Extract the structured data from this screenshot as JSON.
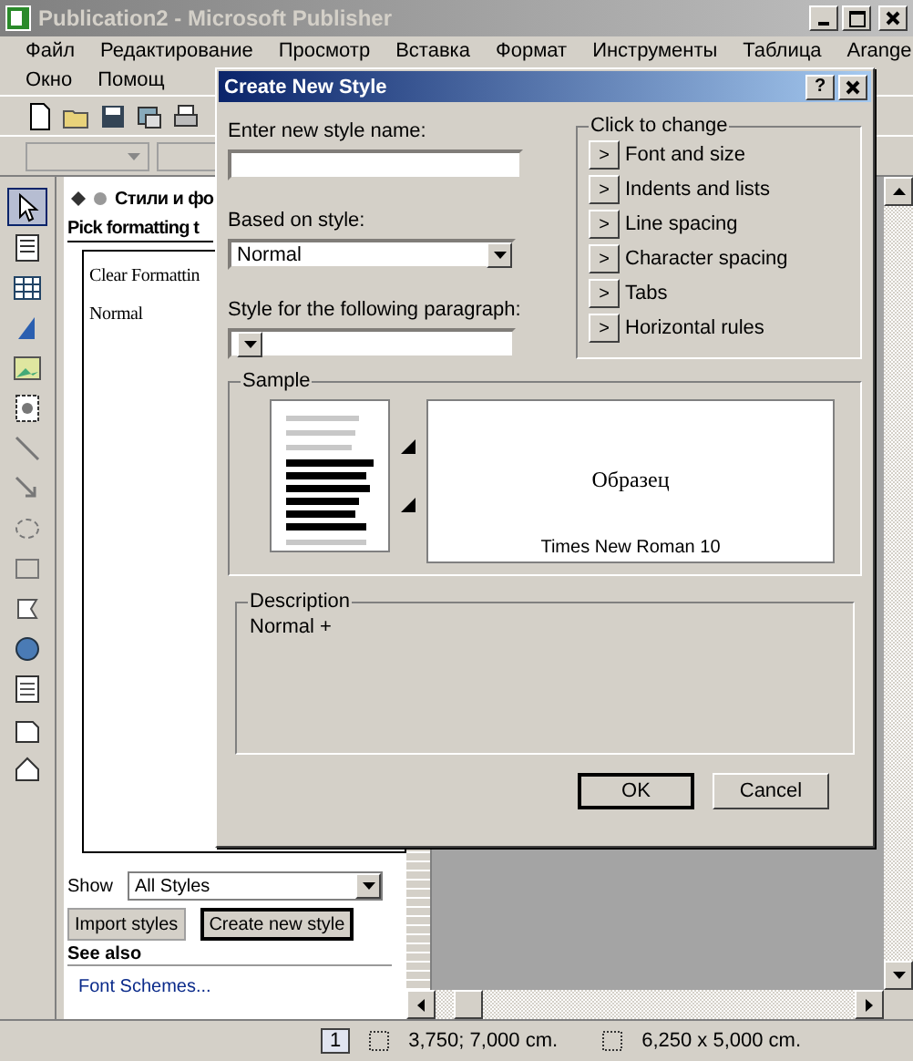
{
  "window": {
    "title": "Publication2 - Microsoft Publisher"
  },
  "menu_rows": [
    [
      "Файл",
      "Редактирование",
      "Просмотр",
      "Вставка",
      "Формат",
      "Инструменты",
      "Таблица",
      "Arange"
    ],
    [
      "Окно",
      "Помощ"
    ]
  ],
  "tools": [
    {
      "kind": "pointer",
      "selected": true
    },
    {
      "kind": "text",
      "selected": false
    },
    {
      "kind": "table",
      "selected": false
    },
    {
      "kind": "wordart",
      "selected": false
    },
    {
      "kind": "picture",
      "selected": false
    },
    {
      "kind": "clip",
      "selected": false
    },
    {
      "kind": "line",
      "selected": false
    },
    {
      "kind": "arrow",
      "selected": false
    },
    {
      "kind": "oval",
      "selected": false
    },
    {
      "kind": "rect",
      "selected": false
    },
    {
      "kind": "shape",
      "selected": false
    },
    {
      "kind": "hotspot",
      "selected": false
    },
    {
      "kind": "form",
      "selected": false
    },
    {
      "kind": "html",
      "selected": false
    },
    {
      "kind": "gallery",
      "selected": false
    }
  ],
  "task_pane": {
    "title": "Стили и фо",
    "subtitle": "Pick formatting t",
    "styles": [
      {
        "label": "Clear Formattin"
      },
      {
        "label": "Normal"
      }
    ],
    "show_label": "Show",
    "show_value": "All Styles",
    "buttons": [
      {
        "label": "Import styles",
        "default": false
      },
      {
        "label": "Create new style",
        "default": true
      }
    ],
    "see_also": "See also",
    "links": [
      "Font Schemes..."
    ]
  },
  "dialog": {
    "title": "Create New Style",
    "help": "?",
    "name_label": "Enter new style name:",
    "based_label": "Based on style:",
    "based_value": "Normal",
    "following_label": "Style for the following paragraph:",
    "change_title": "Click to change",
    "change_items": [
      {
        "arrow": ">",
        "label": "Font and size"
      },
      {
        "arrow": ">",
        "label": "Indents and lists"
      },
      {
        "arrow": ">",
        "label": "Line spacing"
      },
      {
        "arrow": ">",
        "label": "Character spacing"
      },
      {
        "arrow": ">",
        "label": "Tabs"
      },
      {
        "arrow": ">",
        "label": "Horizontal rules"
      }
    ],
    "sample_title": "Sample",
    "sample_text": "Образец",
    "sample_font": "Times New Roman 10",
    "description_title": "Description",
    "description": "Normal +",
    "buttons": [
      {
        "label": "OK",
        "default": true
      },
      {
        "label": "Cancel",
        "default": false
      }
    ]
  },
  "status_bar": {
    "page": "1",
    "position": "3,750; 7,000 cm.",
    "size": "6,250 x 5,000 cm."
  }
}
